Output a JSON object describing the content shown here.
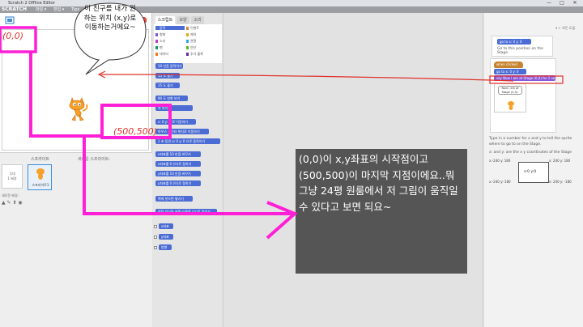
{
  "window": {
    "title": "Scratch 2 Offline Editor",
    "controls": [
      "—",
      "□",
      "✕"
    ]
  },
  "menu": {
    "logo": "SCRATCH",
    "items": [
      "파일 ▾",
      "편집 ▾",
      "Tips",
      "About"
    ]
  },
  "palette": {
    "tabs": [
      "스크립트",
      "모양",
      "소리"
    ],
    "categories_left": [
      "동작",
      "형태",
      "소리",
      "펜",
      "데이터"
    ],
    "categories_right": [
      "이벤트",
      "제어",
      "관찰",
      "연산",
      "추가 블록"
    ],
    "blocks": [
      "10 만큼 움직이기",
      "15 도 돌기",
      "15 도 돌기",
      "90 도 방향 보기",
      "쪽 보기",
      "x: 0 y: 0 로 이동하기",
      "마우스 포인터 위치로 이동하기",
      "1 초 동안 x: 0 y: 0 으로 움직이기",
      "x좌표를 10 만큼 바꾸기",
      "x좌표를 0 (으)로 정하기",
      "y좌표를 10 만큼 바꾸기",
      "y좌표를 0 (으)로 정하기",
      "벽에 닿으면 튕기기",
      "회전 방식을 왼쪽-오른쪽 (으)로 정하기",
      "x좌표",
      "y좌표",
      "방향"
    ]
  },
  "sprite_pane": {
    "header_left": "스프라이트",
    "header_right": "새로운 스프라이트:",
    "stage_label": "무대",
    "stage_sub": "1 배경",
    "new_backdrop": "새로운 배경:",
    "sprite_name": "스프라이트1"
  },
  "annotations": {
    "bubble": "이 친구를 내가 원하는 위치 (x,y)로 이동하는거에요~",
    "origin_label": "(0,0)",
    "end_label": "(500,500)",
    "note": "(0,0)이 x,y좌표의 시작점이고 (500,500)이 마지막 지점이에요..뭐 그냥 24평 원룸에서 저 그림이 움직일 수 있다고 보면 되요~",
    "magenta": "#ff1fd6",
    "arrow_red": "#e0302a"
  },
  "tips": {
    "header": "x  ← 모든 도움",
    "block_example": "go to x: 0 y: 0",
    "block_desc": "Go to this position on the Stage.",
    "script_hat": "when clicked",
    "script_go": "go to x: 0 y: 0",
    "script_say": "say Now I am at Stage (0,0) for 2 secs",
    "speech": "Now I am at Stage (0,0).",
    "text": "Type in a number for x and y to tell the sprite where to go to on the Stage.",
    "text2": "x: and y: are the x y coordinates of the Stage",
    "coords": {
      "tl": "x:-240 y: 180",
      "tr": "x: 240 y: 180",
      "bl": "x:-240 y:-180",
      "br": "x: 240 y: -180",
      "center": "x:0 y:0"
    }
  }
}
